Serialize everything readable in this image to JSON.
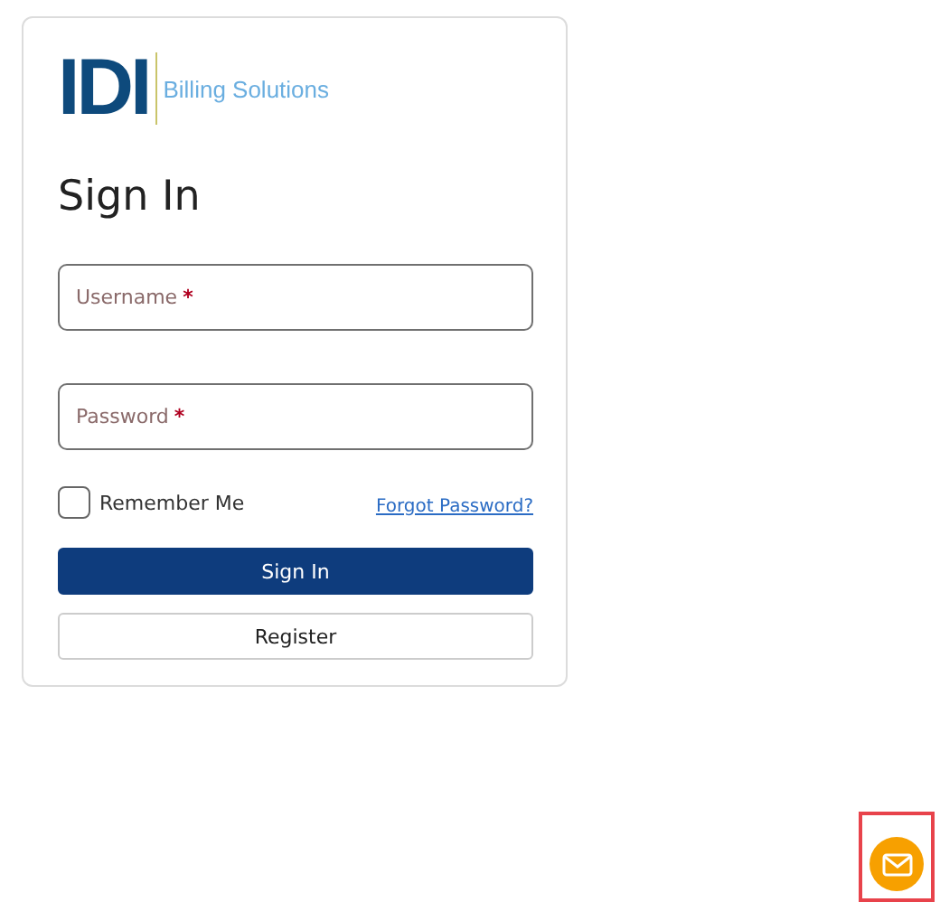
{
  "logo": {
    "mark": "IDI",
    "tagline": "Billing Solutions"
  },
  "title": "Sign In",
  "fields": [
    {
      "placeholder": "Username",
      "required_mark": "*"
    },
    {
      "placeholder": "Password",
      "required_mark": "*"
    }
  ],
  "remember_me": {
    "label": "Remember Me",
    "checked": false
  },
  "forgot_link": "Forgot Password?",
  "buttons": [
    {
      "label": "Sign In",
      "kind": "primary"
    },
    {
      "label": "Register",
      "kind": "secondary"
    }
  ],
  "chat_button": {
    "highlighted": true
  }
}
